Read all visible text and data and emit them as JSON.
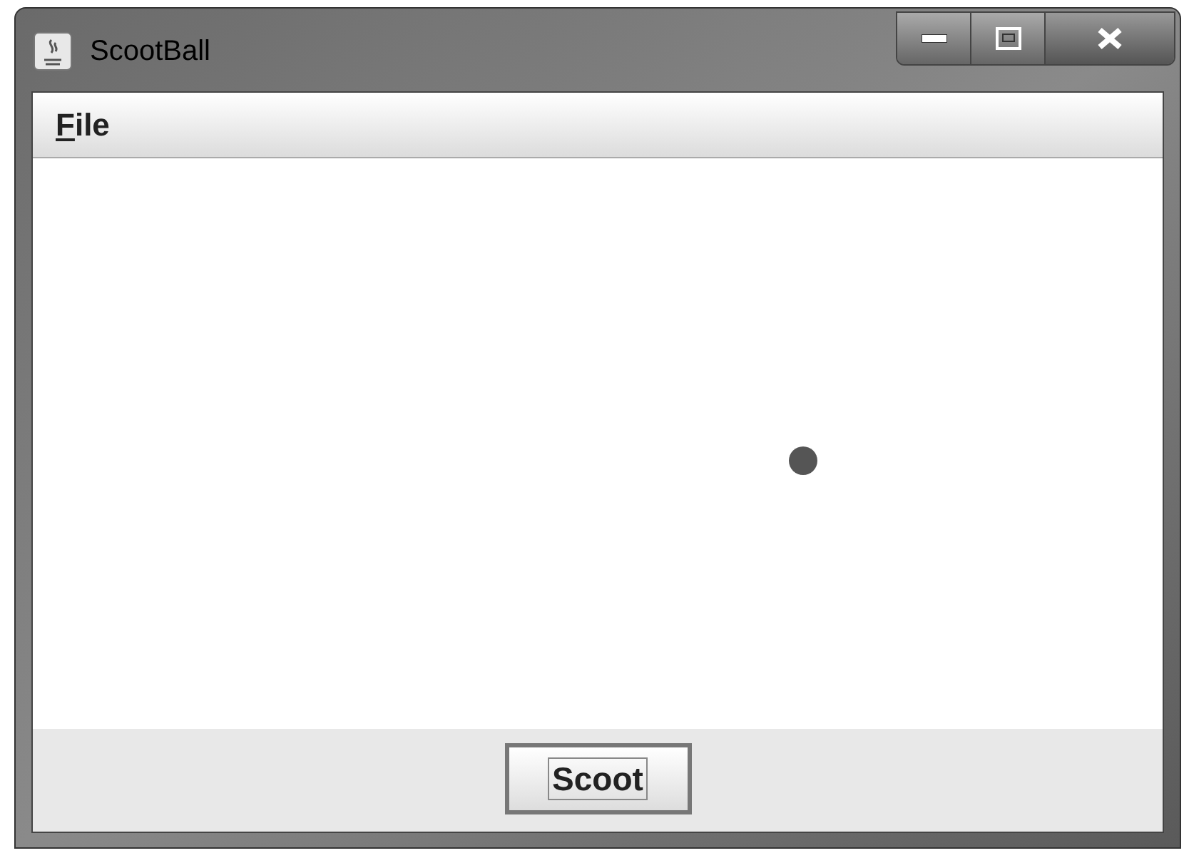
{
  "window": {
    "title": "ScootBall"
  },
  "menu_bar": {
    "items": [
      {
        "label": "File",
        "mnemonic_underlined": true
      }
    ]
  },
  "canvas": {
    "ball_visible": true
  },
  "buttons": [
    {
      "label": "Scoot",
      "focused": true
    }
  ]
}
